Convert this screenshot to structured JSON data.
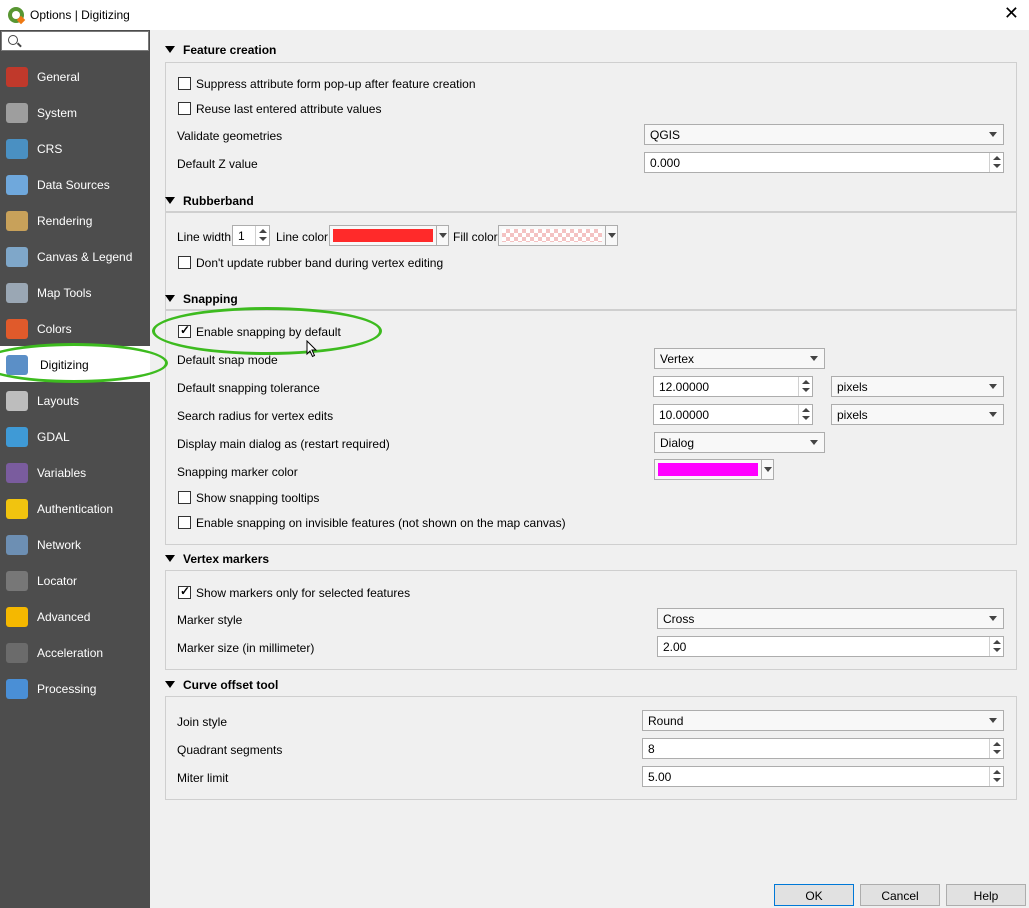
{
  "window": {
    "title": "Options | Digitizing",
    "close": "✕"
  },
  "sidebar": {
    "search_placeholder": "",
    "items": [
      {
        "label": "General",
        "color": "#c0392b"
      },
      {
        "label": "System",
        "color": "#9e9e9e"
      },
      {
        "label": "CRS",
        "color": "#4a90c2"
      },
      {
        "label": "Data Sources",
        "color": "#6fa8dc"
      },
      {
        "label": "Rendering",
        "color": "#c8a15a"
      },
      {
        "label": "Canvas & Legend",
        "color": "#7fa7c9"
      },
      {
        "label": "Map Tools",
        "color": "#9aa7b4"
      },
      {
        "label": "Colors",
        "color": "#e05a2b"
      },
      {
        "label": "Digitizing",
        "color": "#5b8fc7"
      },
      {
        "label": "Layouts",
        "color": "#bdbdbd"
      },
      {
        "label": "GDAL",
        "color": "#3f9ad6"
      },
      {
        "label": "Variables",
        "color": "#7a5c9e"
      },
      {
        "label": "Authentication",
        "color": "#f1c40f"
      },
      {
        "label": "Network",
        "color": "#6d8fb3"
      },
      {
        "label": "Locator",
        "color": "#777777"
      },
      {
        "label": "Advanced",
        "color": "#f5b800"
      },
      {
        "label": "Acceleration",
        "color": "#6b6b6b"
      },
      {
        "label": "Processing",
        "color": "#4a8fd6"
      }
    ]
  },
  "feature_creation": {
    "header": "Feature creation",
    "suppress_label": "Suppress attribute form pop-up after feature creation",
    "reuse_label": "Reuse last entered attribute values",
    "validate_label": "Validate geometries",
    "validate_value": "QGIS",
    "default_z_label": "Default Z value",
    "default_z_value": "0.000"
  },
  "rubberband": {
    "header": "Rubberband",
    "line_width_label": "Line width",
    "line_width_value": "1",
    "line_color_label": "Line color",
    "line_color": "#ff2a2a",
    "fill_color_label": "Fill color",
    "fill_color": "#f4c2c2",
    "dont_update_label": "Don't update rubber band during vertex editing"
  },
  "snapping": {
    "header": "Snapping",
    "enable_label": "Enable snapping by default",
    "mode_label": "Default snap mode",
    "mode_value": "Vertex",
    "tolerance_label": "Default snapping tolerance",
    "tolerance_value": "12.00000",
    "tolerance_unit": "pixels",
    "radius_label": "Search radius for vertex edits",
    "radius_value": "10.00000",
    "radius_unit": "pixels",
    "dialog_label": "Display main dialog as (restart required)",
    "dialog_value": "Dialog",
    "marker_color_label": "Snapping marker color",
    "marker_color": "#ff00ff",
    "tooltips_label": "Show snapping tooltips",
    "invisible_label": "Enable snapping on invisible features (not shown on the map canvas)"
  },
  "vertex_markers": {
    "header": "Vertex markers",
    "selected_only_label": "Show markers only for selected features",
    "style_label": "Marker style",
    "style_value": "Cross",
    "size_label": "Marker size (in millimeter)",
    "size_value": "2.00"
  },
  "curve_offset": {
    "header": "Curve offset tool",
    "join_label": "Join style",
    "join_value": "Round",
    "quadrant_label": "Quadrant segments",
    "quadrant_value": "8",
    "miter_label": "Miter limit",
    "miter_value": "5.00"
  },
  "buttons": {
    "ok": "OK",
    "cancel": "Cancel",
    "help": "Help"
  },
  "highlight_color": "#3dbb1f"
}
